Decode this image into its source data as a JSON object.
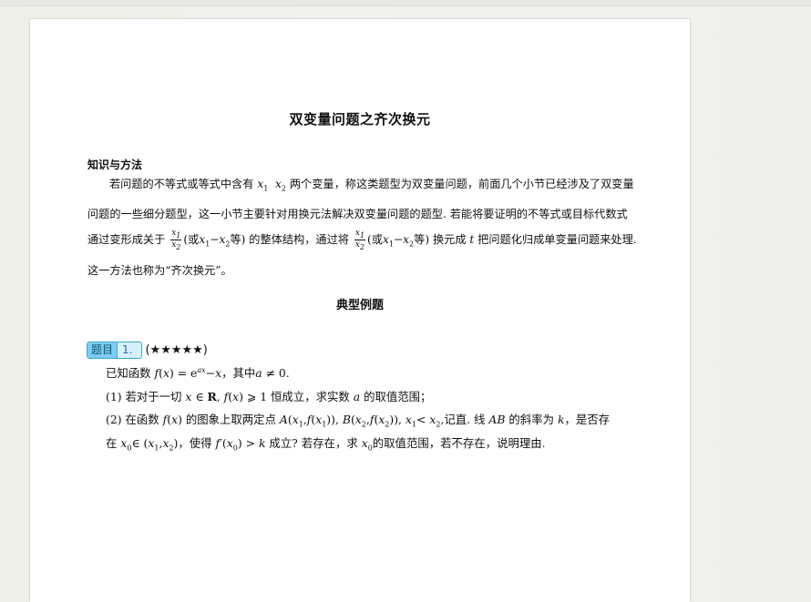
{
  "title": "双变量问题之齐次换元",
  "section_heading": "知识与方法",
  "paragraph": {
    "p1": "若问题的不等式或等式中含有",
    "p2": "两个变量，称这类题型为双变量问题，前面几个小节已经涉及了双变量问题的一些细分题型，这一小节主要针对用换元法解决双变量问题的题型. 若能将要证明的不等式或目标代数式通过变形成关于",
    "p3": "(或",
    "p4": "等) 的整体结构，通过将",
    "p5": "(或",
    "p6": "等) 换元成",
    "p7": "把问题化归成单变量问题来处理. 这一方法也称为“齐次换元”。"
  },
  "subtitle": "典型例题",
  "problem": {
    "tag_label": "题目",
    "number": "1.",
    "difficulty": "(★★★★★)",
    "stem_a": "已知函数",
    "stem_b": "，其中",
    "part1_a": "(1) 若对于一切",
    "part1_b": "恒成立，求实数",
    "part1_c": "的取值范围；",
    "part2_a": "(2) 在函数",
    "part2_b": "的图象上取两定点",
    "part2_c": "记直. 线",
    "part2_d": "的斜率为",
    "part2_e": "，是否存",
    "part3_a": "在",
    "part3_b": "，使得",
    "part3_c": "成立? 若存在，求",
    "part3_d": "的取值范围，若不存在，说明理由."
  }
}
